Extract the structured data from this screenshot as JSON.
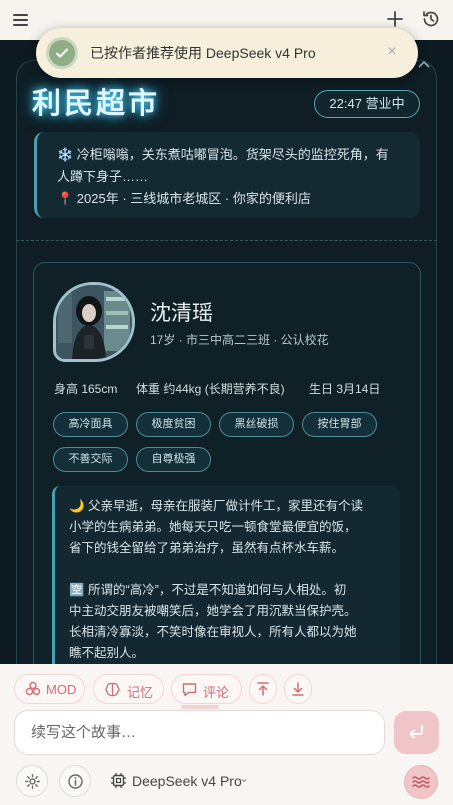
{
  "toast": {
    "message": "已按作者推荐使用 DeepSeek v4 Pro",
    "close_glyph": "×"
  },
  "scene": {
    "store_name": "利民超市",
    "clock": "22:47 营业中",
    "notice": {
      "line1": "❄️ 冷柜嗡嗡，关东煮咕嘟冒泡。货架尽头的监控死角，有",
      "line2": "人蹲下身子……",
      "line3": "📍 2025年 · 三线城市老城区 · 你家的便利店"
    },
    "character": {
      "name": "沈清瑶",
      "meta": "17岁 · 市三中高二三班 · 公认校花",
      "stats": [
        "身高 165cm",
        "体重 约44kg (长期营养不良)",
        "生日 3月14日"
      ],
      "tags": [
        "高冷面具",
        "极度贫困",
        "黑丝破损",
        "按住胃部",
        "不善交际",
        "自尊极强"
      ],
      "bio": {
        "para1_l1": "🌙 父亲早逝，母亲在服装厂做计件工，家里还有个读",
        "para1_l2": "小学的生病弟弟。她每天只吃一顿食堂最便宜的饭，",
        "para1_l3": "省下的钱全留给了弟弟治疗，虽然有点杯水车薪。",
        "para2_l1": "🈳 所谓的“高冷”，不过是不知道如何与人相处。初",
        "para2_l2": "中主动交朋友被嘲笑后，她学会了用沉默当保护壳。",
        "para2_l3": "长相清冷寡淡，不笑时像在审视人，所有人都以为她",
        "para2_l4": "瞧不起别人。"
      }
    }
  },
  "toolbar": {
    "mod_label": "MOD",
    "memory_label": "记忆",
    "comment_label": "评论"
  },
  "input": {
    "placeholder": "续写这个故事…"
  },
  "model": {
    "name": "DeepSeek v4 Pro"
  },
  "colors": {
    "accent_pink": "#d06e74",
    "neon_cyan": "#56d8ff",
    "card_border": "#2f5560"
  }
}
